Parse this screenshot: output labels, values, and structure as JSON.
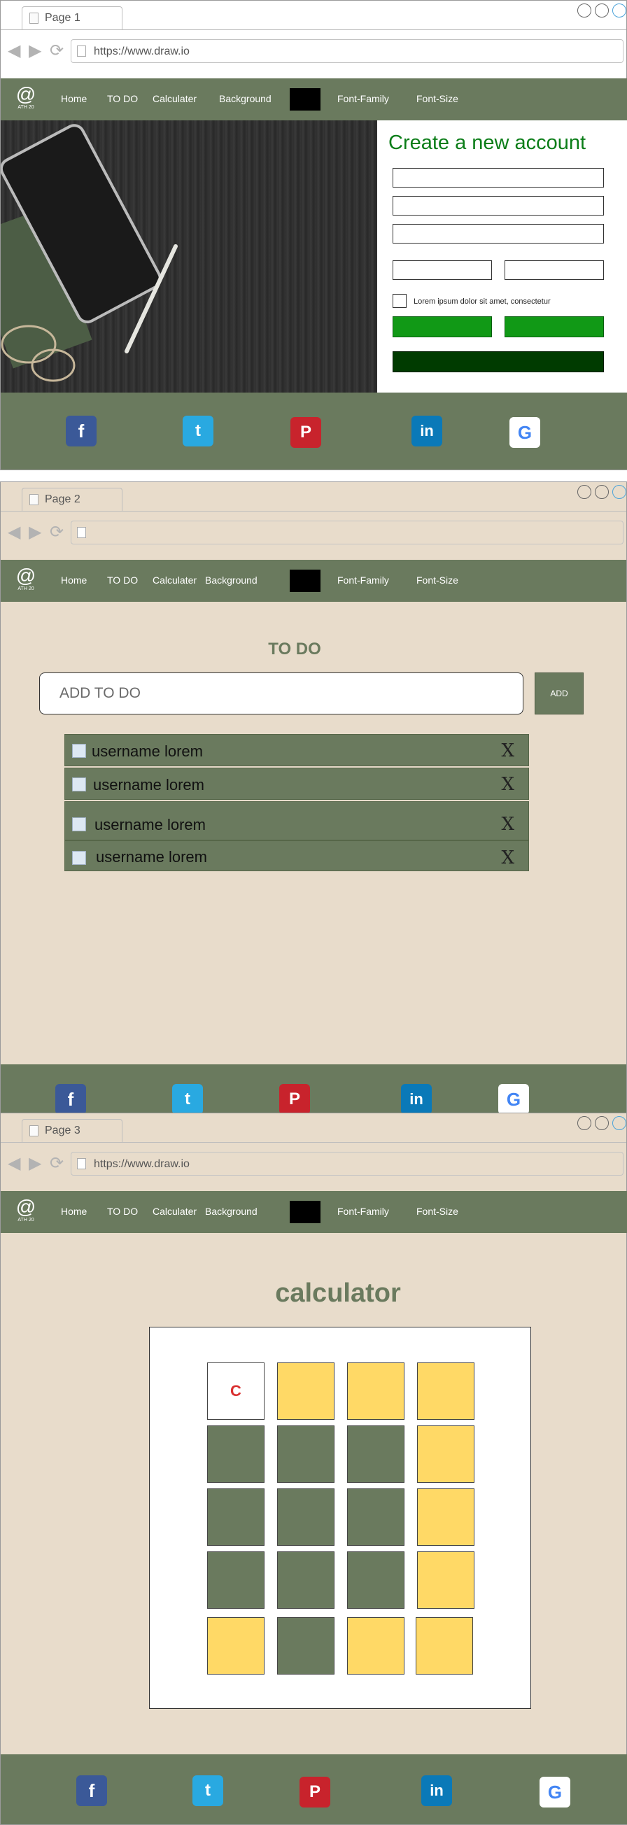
{
  "nav": {
    "items": [
      "Home",
      "TO DO",
      "Calculater",
      "Background",
      "Font-Family",
      "Font-Size"
    ],
    "logo_sub": "ATH 20"
  },
  "social": [
    {
      "name": "facebook-icon",
      "glyph": "f",
      "color": "#3b5998"
    },
    {
      "name": "twitter-icon",
      "glyph": "t",
      "color": "#29a9e1"
    },
    {
      "name": "pinterest-icon",
      "glyph": "P",
      "color": "#c8232c"
    },
    {
      "name": "linkedin-icon",
      "glyph": "in",
      "color": "#0a79b8"
    },
    {
      "name": "google-icon",
      "glyph": "G",
      "color": "#ffffff"
    }
  ],
  "page1": {
    "tab": "Page 1",
    "url": "https://www.draw.io",
    "form_title": "Create a new account",
    "checkbox_label": "Lorem ipsum dolor sit amet, consectetur"
  },
  "page2": {
    "tab": "Page 2",
    "url": "",
    "title": "TO DO",
    "input_placeholder": "ADD TO DO",
    "add_label": "ADD",
    "todos": [
      "username lorem",
      "username lorem",
      "username lorem",
      "username lorem"
    ]
  },
  "page3": {
    "tab": "Page 3",
    "url": "https://www.draw.io",
    "title": "calculator",
    "clear_label": "C"
  },
  "colors": {
    "brand": "#6a7a5e",
    "page_bg": "#e8dccb",
    "accent_yellow": "#ffd966",
    "green_button": "#119916",
    "dark_green": "#003b00"
  }
}
